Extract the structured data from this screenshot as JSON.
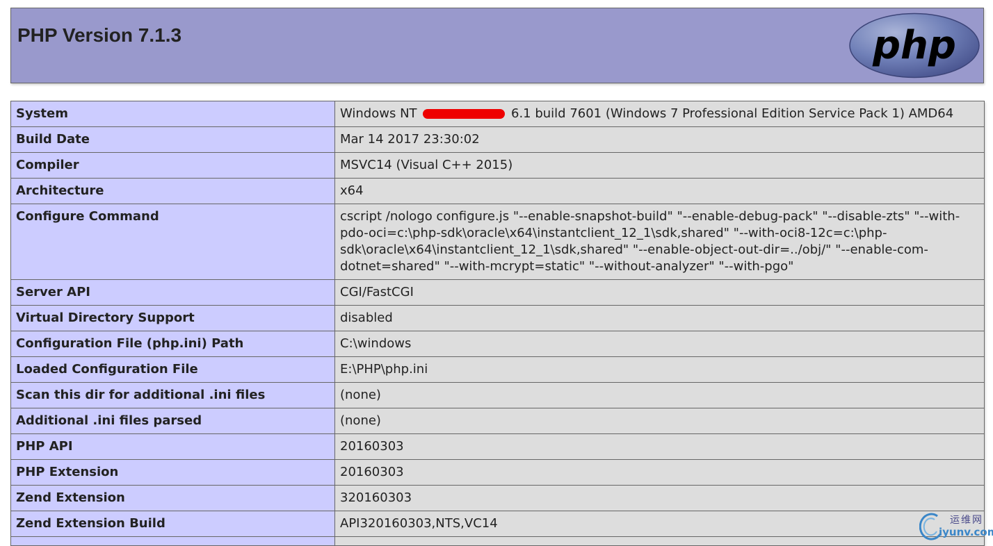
{
  "header": {
    "title": "PHP Version 7.1.3",
    "logo_text": "php"
  },
  "rows": [
    {
      "key": "System",
      "value_before": "Windows NT ",
      "value_redacted": true,
      "value_after": " 6.1 build 7601 (Windows 7 Professional Edition Service Pack 1) AMD64"
    },
    {
      "key": "Build Date",
      "value": "Mar 14 2017 23:30:02"
    },
    {
      "key": "Compiler",
      "value": "MSVC14 (Visual C++ 2015)"
    },
    {
      "key": "Architecture",
      "value": "x64"
    },
    {
      "key": "Configure Command",
      "value": "cscript /nologo configure.js \"--enable-snapshot-build\" \"--enable-debug-pack\" \"--disable-zts\" \"--with-pdo-oci=c:\\php-sdk\\oracle\\x64\\instantclient_12_1\\sdk,shared\" \"--with-oci8-12c=c:\\php-sdk\\oracle\\x64\\instantclient_12_1\\sdk,shared\" \"--enable-object-out-dir=../obj/\" \"--enable-com-dotnet=shared\" \"--with-mcrypt=static\" \"--without-analyzer\" \"--with-pgo\""
    },
    {
      "key": "Server API",
      "value": "CGI/FastCGI"
    },
    {
      "key": "Virtual Directory Support",
      "value": "disabled"
    },
    {
      "key": "Configuration File (php.ini) Path",
      "value": "C:\\windows"
    },
    {
      "key": "Loaded Configuration File",
      "value": "E:\\PHP\\php.ini"
    },
    {
      "key": "Scan this dir for additional .ini files",
      "value": "(none)"
    },
    {
      "key": "Additional .ini files parsed",
      "value": "(none)"
    },
    {
      "key": "PHP API",
      "value": "20160303"
    },
    {
      "key": "PHP Extension",
      "value": "20160303"
    },
    {
      "key": "Zend Extension",
      "value": "320160303"
    },
    {
      "key": "Zend Extension Build",
      "value": "API320160303,NTS,VC14"
    },
    {
      "key": "",
      "value": ""
    }
  ],
  "watermark": {
    "cn_text": "运维网",
    "en_text": "iyunv.com"
  },
  "colors": {
    "header_bg": "#9999cc",
    "key_cell_bg": "#ccccff",
    "value_cell_bg": "#dddddd",
    "redaction": "#ee0000",
    "logo_bg": "#6c7eb7"
  }
}
